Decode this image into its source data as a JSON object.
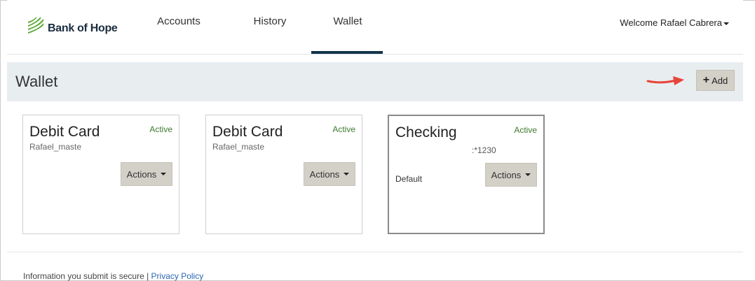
{
  "brand": {
    "name": "Bank of Hope",
    "logo_icon": "bank-of-hope-logo-icon",
    "colors": {
      "green": "#5aa832",
      "navy": "#12344a"
    }
  },
  "nav": {
    "items": [
      {
        "label": "Accounts"
      },
      {
        "label": "History"
      },
      {
        "label": "Wallet",
        "active": true
      }
    ],
    "welcome": "Welcome Rafael Cabrera"
  },
  "page": {
    "title": "Wallet",
    "add_label": "Add",
    "add_icon": "plus-icon",
    "annotation_arrow_color": "#e8443a"
  },
  "cards": [
    {
      "title": "Debit Card",
      "subtitle": "Rafael_maste",
      "status": "Active",
      "actions_label": "Actions"
    },
    {
      "title": "Debit Card",
      "subtitle": "Rafael_maste",
      "status": "Active",
      "actions_label": "Actions"
    },
    {
      "title": "Checking",
      "account": ":*1230",
      "status": "Active",
      "default_label": "Default",
      "actions_label": "Actions"
    }
  ],
  "footer": {
    "text": "Information you submit is secure | ",
    "privacy_link": "Privacy Policy"
  }
}
